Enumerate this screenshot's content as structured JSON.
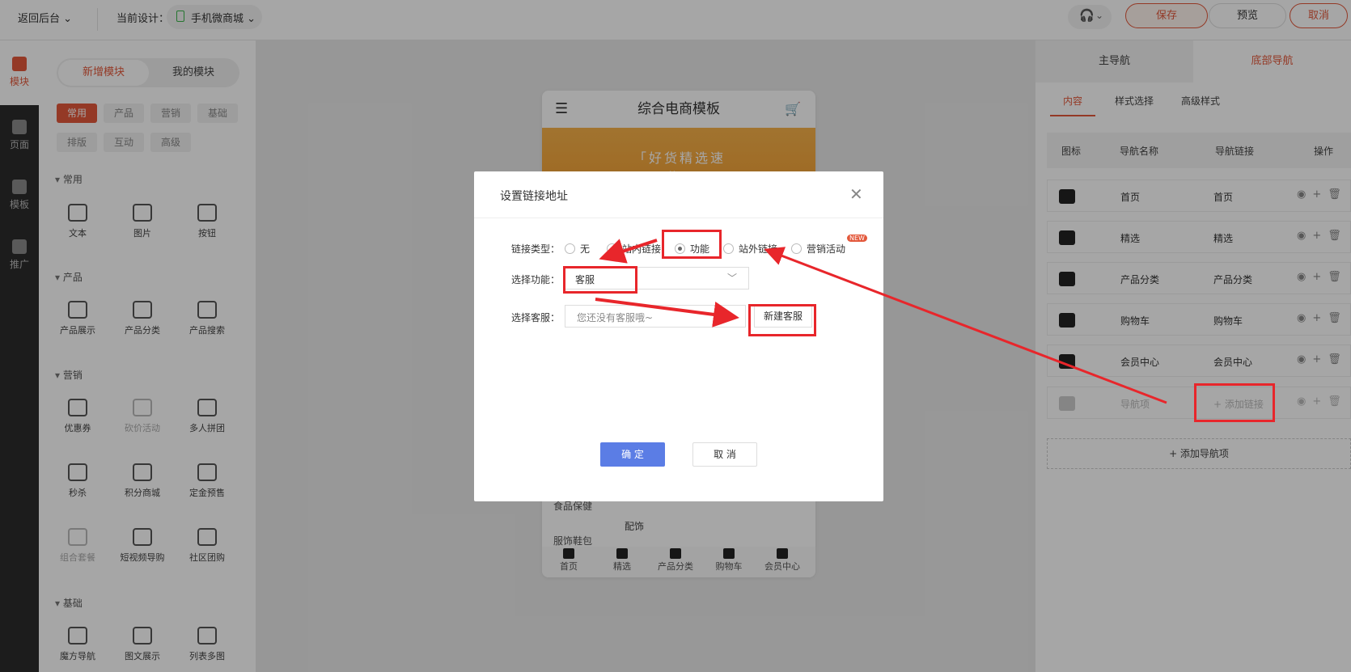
{
  "topbar": {
    "back": "返回后台",
    "design_label": "当前设计：",
    "design_value": "手机微商城",
    "save": "保存",
    "preview": "预览",
    "cancel": "取消"
  },
  "leftnav": [
    {
      "label": "模块",
      "active": true
    },
    {
      "label": "页面",
      "active": false
    },
    {
      "label": "模板",
      "active": false
    },
    {
      "label": "推广",
      "active": false
    }
  ],
  "modpanel": {
    "tab_new": "新增模块",
    "tab_mine": "我的模块",
    "chips_row1": [
      "常用",
      "产品",
      "营销",
      "基础"
    ],
    "chips_row2": [
      "排版",
      "互动",
      "高级"
    ],
    "sections": [
      {
        "title": "常用",
        "items": [
          "文本",
          "图片",
          "按钮"
        ]
      },
      {
        "title": "产品",
        "items": [
          "产品展示",
          "产品分类",
          "产品搜索"
        ]
      },
      {
        "title": "营销",
        "items": [
          "优惠券",
          "砍价活动",
          "多人拼团",
          "秒杀",
          "积分商城",
          "定金预售",
          "组合套餐",
          "短视频导购",
          "社区团购"
        ]
      },
      {
        "title": "基础",
        "items": [
          "魔方导航",
          "图文展示",
          "列表多图"
        ]
      }
    ]
  },
  "phone": {
    "title": "综合电商模板",
    "banner_text": "「好货精选速递」",
    "side1": "食品保健",
    "side2": "服饰鞋包",
    "accessory": "配饰",
    "tabbar": [
      "首页",
      "精选",
      "产品分类",
      "购物车",
      "会员中心"
    ]
  },
  "rightpanel": {
    "tab_main": "主导航",
    "tab_bottom": "底部导航",
    "subtabs": [
      "内容",
      "样式选择",
      "高级样式"
    ],
    "headers": [
      "图标",
      "导航名称",
      "导航链接",
      "操作"
    ],
    "rows": [
      {
        "name": "首页",
        "link": "首页"
      },
      {
        "name": "精选",
        "link": "精选"
      },
      {
        "name": "产品分类",
        "link": "产品分类"
      },
      {
        "name": "购物车",
        "link": "购物车"
      },
      {
        "name": "会员中心",
        "link": "会员中心"
      },
      {
        "name": "导航项",
        "link": "+ 添加链接"
      }
    ],
    "add_nav": "+ 添加导航项"
  },
  "dialog": {
    "title": "设置链接地址",
    "link_type_label": "链接类型：",
    "radios": [
      "无",
      "站内链接",
      "功能",
      "站外链接",
      "营销活动"
    ],
    "selected_radio": "功能",
    "new_badge": "NEW",
    "func_label": "选择功能：",
    "func_value": "客服",
    "cs_label": "选择客服：",
    "cs_placeholder": "您还没有客服哦~",
    "new_cs": "新建客服",
    "ok": "确 定",
    "cancel": "取 消"
  },
  "colors": {
    "accent": "#e3583b",
    "primary": "#5b7de5",
    "annotation": "#e8262b"
  }
}
